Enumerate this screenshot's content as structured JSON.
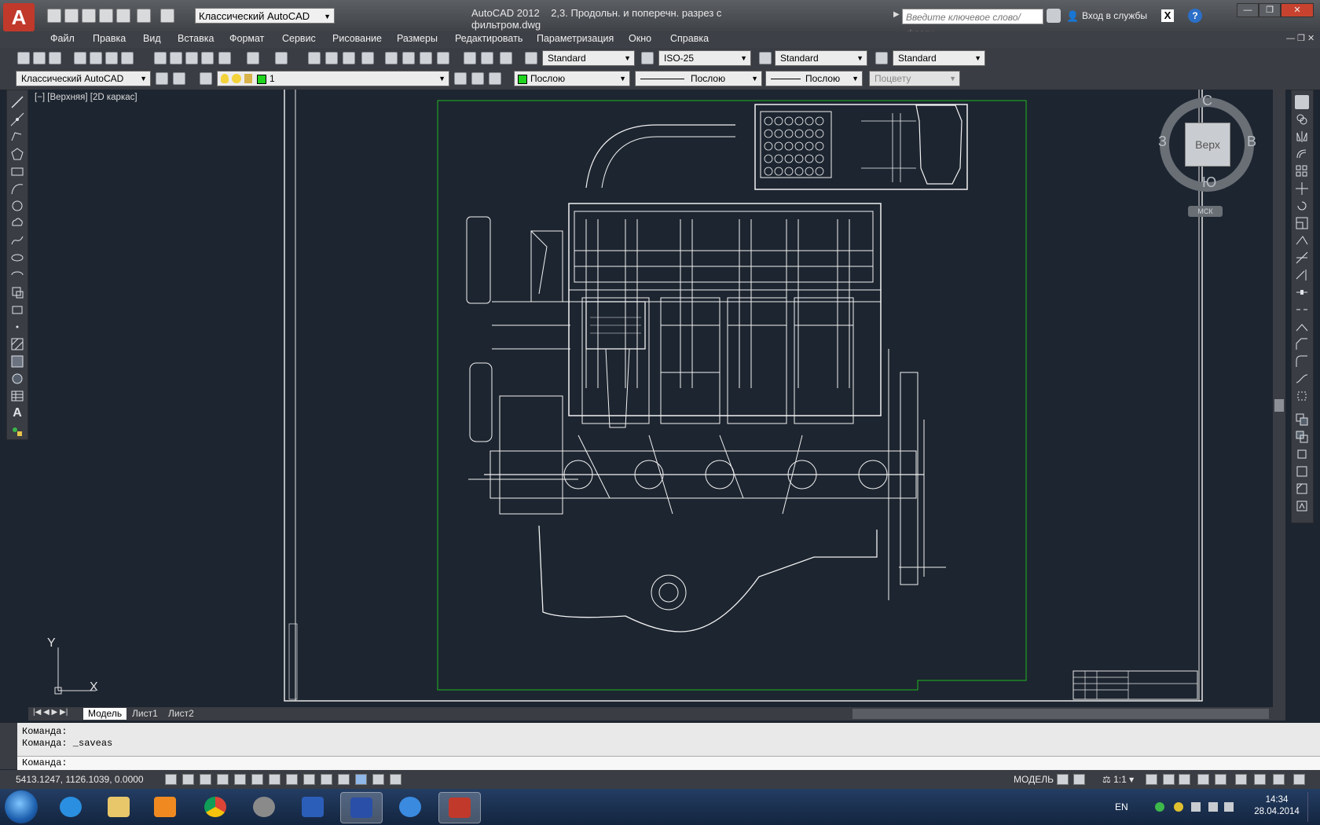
{
  "app": {
    "title": "AutoCAD 2012",
    "document_title": "2,3. Продольн. и поперечн. разрез с фильтром.dwg",
    "workspace": "Классический AutoCAD",
    "search_placeholder": "Введите ключевое слово/фразу",
    "login_label": "Вход в службы",
    "help_icon": "?",
    "window_buttons": {
      "minimize": "—",
      "restore": "❐",
      "close": "✕"
    }
  },
  "menu": [
    "Файл",
    "Правка",
    "Вид",
    "Вставка",
    "Формат",
    "Сервис",
    "Рисование",
    "Размеры",
    "Редактировать",
    "Параметризация",
    "Окно",
    "Справка"
  ],
  "toolbar_styles": {
    "text_style": "Standard",
    "dim_style": "ISO-25",
    "table_style": "Standard",
    "mleader_style": "Standard"
  },
  "toolbar_layers": {
    "workspace": "Классический AutoCAD",
    "layer": "1",
    "color": "Послою",
    "linetype": "Послою",
    "lineweight": "Послою",
    "plotstyle": "Поцвету"
  },
  "viewport": {
    "label": "[−] [Верхняя] [2D каркас]",
    "viewcube": {
      "north": "С",
      "south": "Ю",
      "west": "З",
      "east": "В",
      "face": "Верх"
    },
    "ucs_label": "МСК",
    "ucs_axes": {
      "x": "X",
      "y": "Y"
    }
  },
  "drawing_frame_color": "#ffffff",
  "drawing_bbox_color": "#1fb81f",
  "tabs": [
    "Модель",
    "Лист1",
    "Лист2"
  ],
  "active_tab": "Модель",
  "command": {
    "history": [
      "Команда:",
      "Команда:  _saveas"
    ],
    "prompt": "Команда:"
  },
  "status": {
    "coordinates": "5413.1247, 1126.1039, 0.0000",
    "model_label": "МОДЕЛЬ",
    "anno_scale": "1:1"
  },
  "taskbar": {
    "language": "EN",
    "time": "14:34",
    "date": "28.04.2014",
    "apps": [
      "internet-explorer",
      "file-explorer",
      "media-player",
      "chrome",
      "app-gray",
      "word",
      "save-app",
      "k-app",
      "autocad"
    ]
  }
}
